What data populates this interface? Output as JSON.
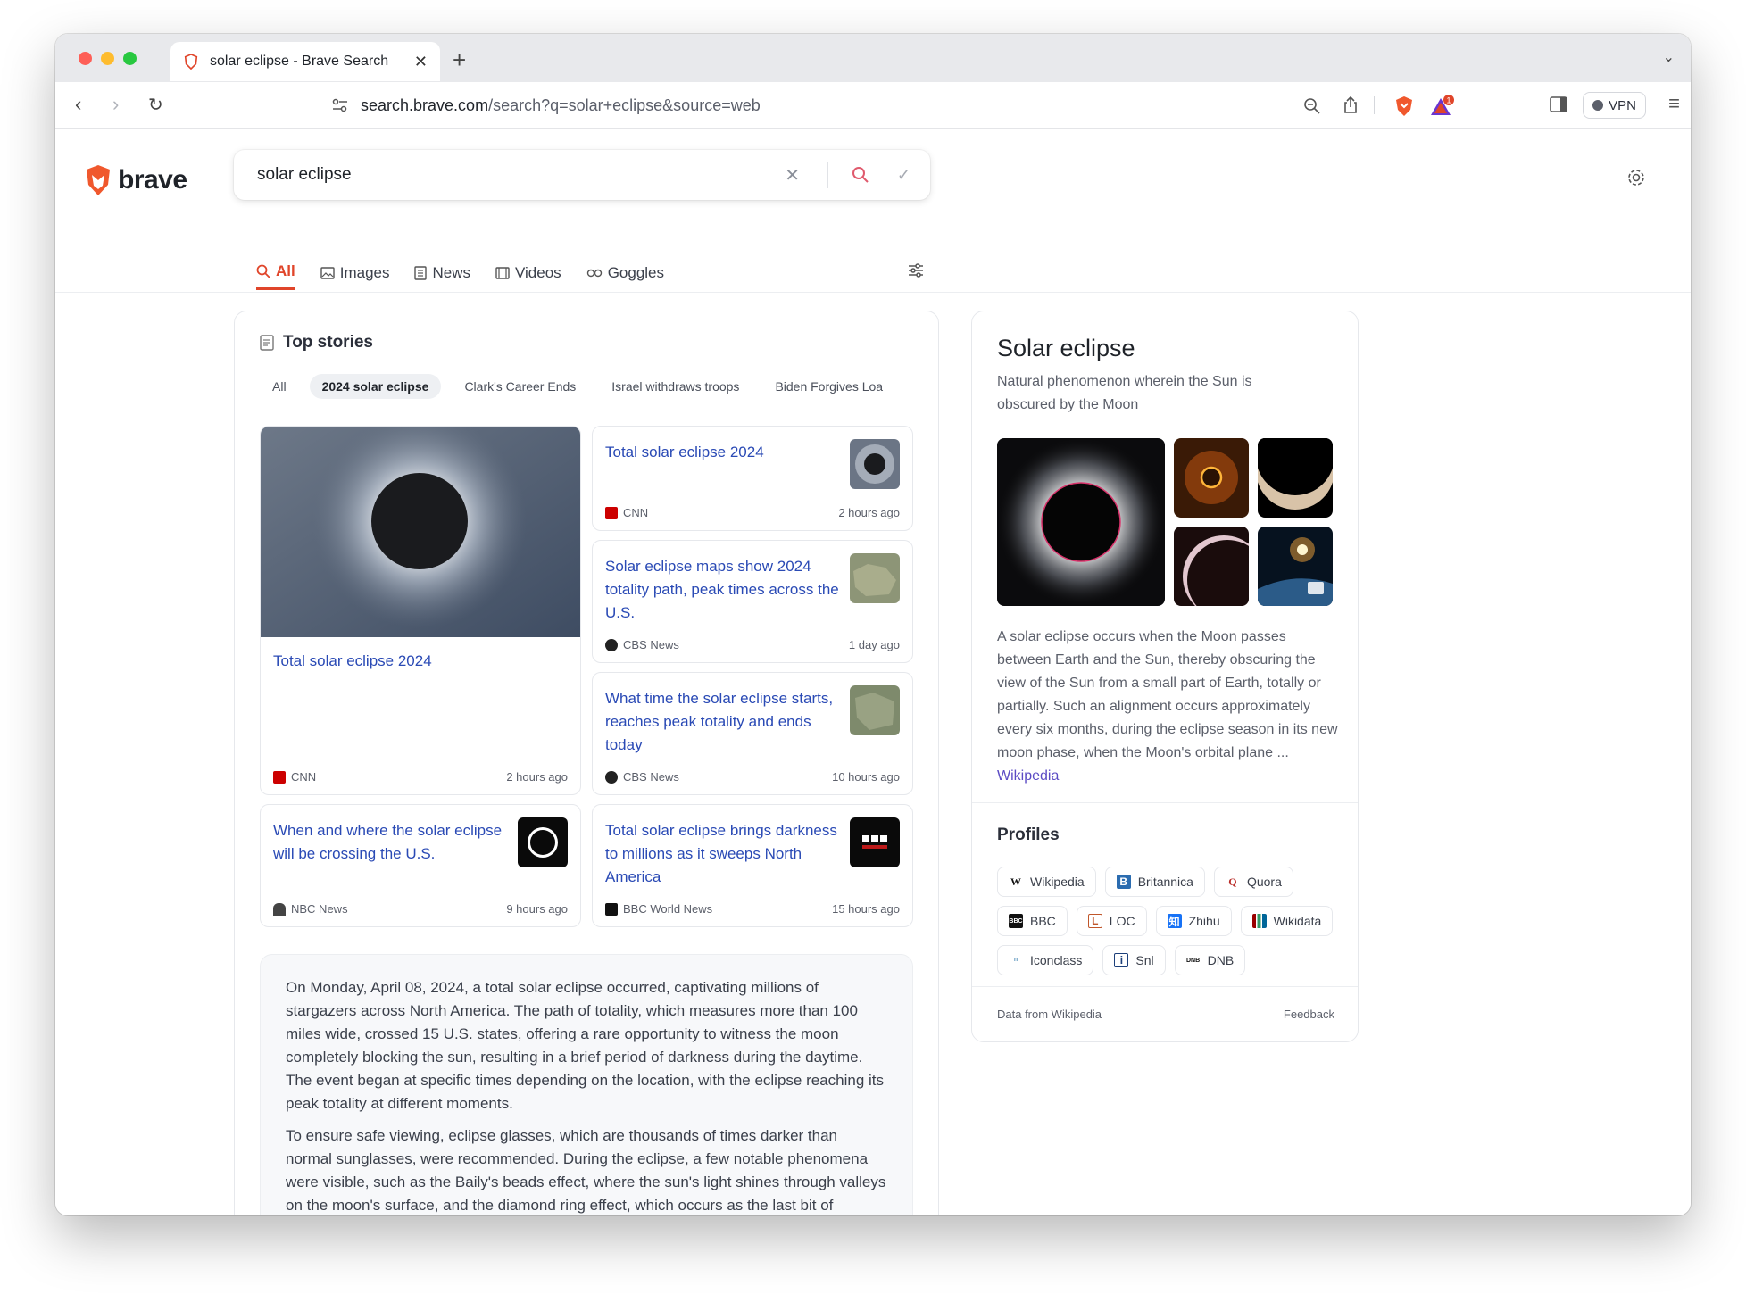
{
  "browser": {
    "tab_title": "solar eclipse - Brave Search",
    "url_host": "search.brave.com",
    "url_path": "/search?q=solar+eclipse&source=web",
    "vpn_label": "VPN",
    "notification_count": "1"
  },
  "brand": {
    "name": "brave",
    "accent": "#e0452a"
  },
  "search": {
    "query": "solar eclipse"
  },
  "nav_tabs": [
    {
      "label": "All",
      "active": true
    },
    {
      "label": "Images"
    },
    {
      "label": "News"
    },
    {
      "label": "Videos"
    },
    {
      "label": "Goggles"
    }
  ],
  "top_stories": {
    "title": "Top stories",
    "chips": [
      "All",
      "2024 solar eclipse",
      "Clark's Career Ends",
      "Israel withdraws troops",
      "Biden Forgives Loa"
    ],
    "active_chip": "2024 solar eclipse",
    "stories": [
      {
        "title": "Total solar eclipse 2024",
        "source": "CNN",
        "time": "2 hours ago"
      },
      {
        "title": "Total solar eclipse 2024",
        "source": "CNN",
        "time": "2 hours ago"
      },
      {
        "title": "Solar eclipse maps show 2024 totality path, peak times across the U.S.",
        "source": "CBS News",
        "time": "1 day ago"
      },
      {
        "title": "What time the solar eclipse starts, reaches peak totality and ends today",
        "source": "CBS News",
        "time": "10 hours ago"
      },
      {
        "title": "When and where the solar eclipse will be crossing the U.S.",
        "source": "NBC News",
        "time": "9 hours ago"
      },
      {
        "title": "Total solar eclipse brings darkness to millions as it sweeps North America",
        "source": "BBC World News",
        "time": "15 hours ago"
      }
    ]
  },
  "summary": {
    "p1": "On Monday, April 08, 2024, a total solar eclipse occurred, captivating millions of stargazers across North America. The path of totality, which measures more than 100 miles wide, crossed 15 U.S. states, offering a rare opportunity to witness the moon completely blocking the sun, resulting in a brief period of darkness during the daytime. The event began at specific times depending on the location, with the eclipse reaching its peak totality at different moments.",
    "p2": "To ensure safe viewing, eclipse glasses, which are thousands of times darker than normal sunglasses, were recommended. During the eclipse, a few notable phenomena were visible, such as the Baily's beads effect, where the sun's light shines through valleys on the moon's surface, and the diamond ring effect, which occurs as the last bit of sunlight peeks out before and after totality."
  },
  "infobox": {
    "title": "Solar eclipse",
    "subtitle": "Natural phenomenon wherein the Sun is obscured by the Moon",
    "description": "A solar eclipse occurs when the Moon passes between Earth and the Sun, thereby obscuring the view of the Sun from a small part of Earth, totally or partially. Such an alignment occurs approximately every six months, during the eclipse season in its new moon phase, when the Moon's orbital plane ... ",
    "source_link": "Wikipedia",
    "profiles_title": "Profiles",
    "profiles": [
      "Wikipedia",
      "Britannica",
      "Quora",
      "BBC",
      "LOC",
      "Zhihu",
      "Wikidata",
      "Iconclass",
      "Snl",
      "DNB"
    ],
    "data_from": "Data from Wikipedia",
    "feedback": "Feedback"
  }
}
